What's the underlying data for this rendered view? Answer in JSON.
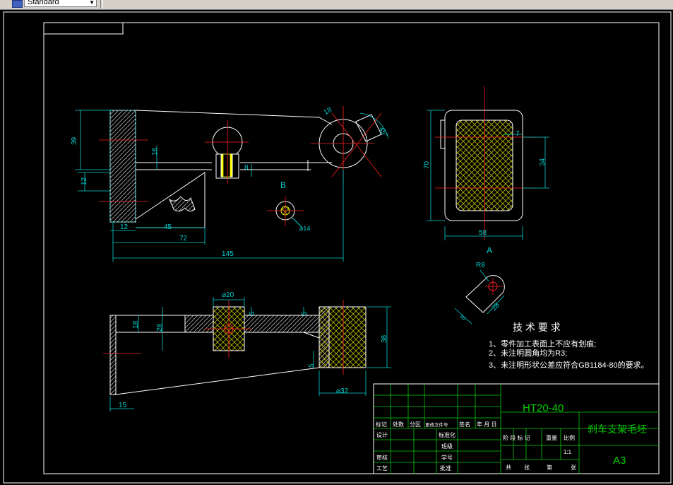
{
  "toolbar": {
    "layer_combo_value": "Standard"
  },
  "drawing": {
    "dims": {
      "d39": "39",
      "d12a": "12",
      "d12b": "12",
      "d45": "45",
      "d72": "72",
      "d145": "145",
      "d16": "16",
      "d8": "8",
      "d18": "18",
      "d45deg": "45°",
      "d14": "⌀14",
      "d70": "70",
      "d58": "58",
      "d34": "34",
      "d7": "7",
      "d20": "⌀20",
      "d5a": "5",
      "d5b": "5",
      "d18b": "18",
      "d28": "28",
      "d38": "38",
      "d5c": "5",
      "d32": "⌀32",
      "d15": "15",
      "r8": "R8",
      "d8b": "8",
      "d28b": "28"
    },
    "view_labels": {
      "b": "B",
      "a": "A"
    },
    "tech": {
      "title": "技 术 要 求",
      "line1": "1、零件加工表面上不应有划痕;",
      "line2": "2、未注明圆角均为R3;",
      "line3": "3、未注明形状公差应符合GB1184-80的要求。"
    },
    "title_block": {
      "material": "HT20-40",
      "part_name": "刹车支架毛坯",
      "sheet_size": "A3",
      "scale": "1:1",
      "h_mark": "标记",
      "h_count": "处数",
      "h_zone": "分区",
      "h_docno": "更改文件号",
      "h_sign": "签名",
      "h_date": "年 月 日",
      "design": "设计",
      "standardize": "标准化",
      "review": "审核",
      "process": "工艺",
      "class": "班级",
      "student_id": "学号",
      "approve": "批准",
      "stage_mark": "阶 段 标 记",
      "weight": "重量",
      "ratio": "比例",
      "total_sheets": "共",
      "sheet_label": "张",
      "sheet_no": "第",
      "sheet_label2": "张"
    }
  }
}
